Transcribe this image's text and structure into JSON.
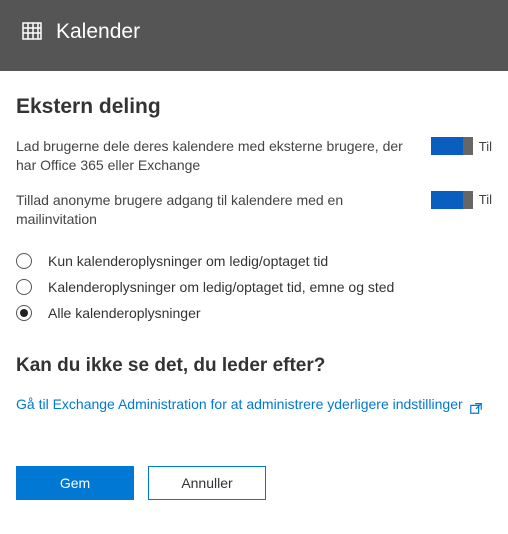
{
  "header": {
    "title": "Kalender"
  },
  "section": {
    "title": "Ekstern deling",
    "settings": [
      {
        "label": "Lad brugerne dele deres kalendere med eksterne brugere, der har Office 365 eller Exchange",
        "state_text": "Til",
        "on": true
      },
      {
        "label": "Tillad anonyme brugere adgang til kalendere med en mailinvitation",
        "state_text": "Til",
        "on": true
      }
    ],
    "radios": [
      {
        "label": "Kun kalenderoplysninger om ledig/optaget tid",
        "selected": false
      },
      {
        "label": "Kalenderoplysninger om ledig/optaget tid, emne og sted",
        "selected": false
      },
      {
        "label": "Alle kalenderoplysninger",
        "selected": true
      }
    ]
  },
  "help": {
    "title": "Kan du ikke se det, du leder efter?",
    "link_text": "Gå til Exchange Administration for at administrere yderligere indstillinger"
  },
  "buttons": {
    "save": "Gem",
    "cancel": "Annuller"
  },
  "icons": {
    "calendar": "calendar-icon",
    "external": "external-link-icon"
  }
}
